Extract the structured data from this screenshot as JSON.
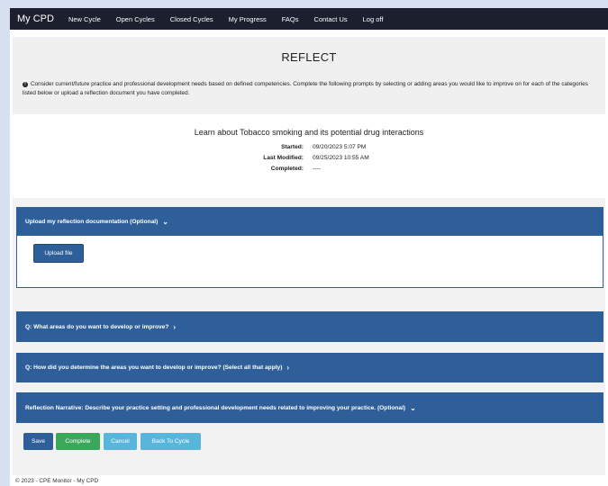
{
  "nav": {
    "brand": "My CPD",
    "items": [
      "New Cycle",
      "Open Cycles",
      "Closed Cycles",
      "My Progress",
      "FAQs",
      "Contact Us",
      "Log off"
    ]
  },
  "reflect": {
    "title": "REFLECT",
    "instructions": "Consider current/future practice and professional development needs based on defined competencies. Complete the following prompts by selecting or adding areas you would like to improve on for each of the categories listed below or upload a reflection document you have completed."
  },
  "activity": {
    "title": "Learn about Tobacco smoking and its potential drug interactions",
    "started_label": "Started:",
    "started_value": "09/20/2023 5:07 PM",
    "modified_label": "Last Modified:",
    "modified_value": "09/25/2023 10:55 AM",
    "completed_label": "Completed:",
    "completed_value": "----"
  },
  "panels": {
    "upload_header": "Upload my reflection documentation (Optional)",
    "upload_button": "Upload file",
    "q1": "Q: What areas do you want to develop or improve?",
    "q2": "Q: How did you determine the areas you want to develop or improve? (Select all that apply)",
    "narrative": "Reflection Narrative: Describe your practice setting and professional development needs related to improving your practice. (Optional)"
  },
  "actions": {
    "save": "Save",
    "complete": "Complete",
    "cancel": "Cancel",
    "back": "Back To Cycle"
  },
  "footer": "© 2023 - CPE Monitor - My CPD",
  "icons": {
    "info": "info-circle-icon",
    "chevron_down": "chevron-down-icon",
    "chevron_right": "chevron-right-icon"
  },
  "colors": {
    "navbar": "#1c1f2e",
    "panel": "#2f5f99",
    "complete": "#3aa858",
    "info_buttons": "#57b6d9"
  }
}
